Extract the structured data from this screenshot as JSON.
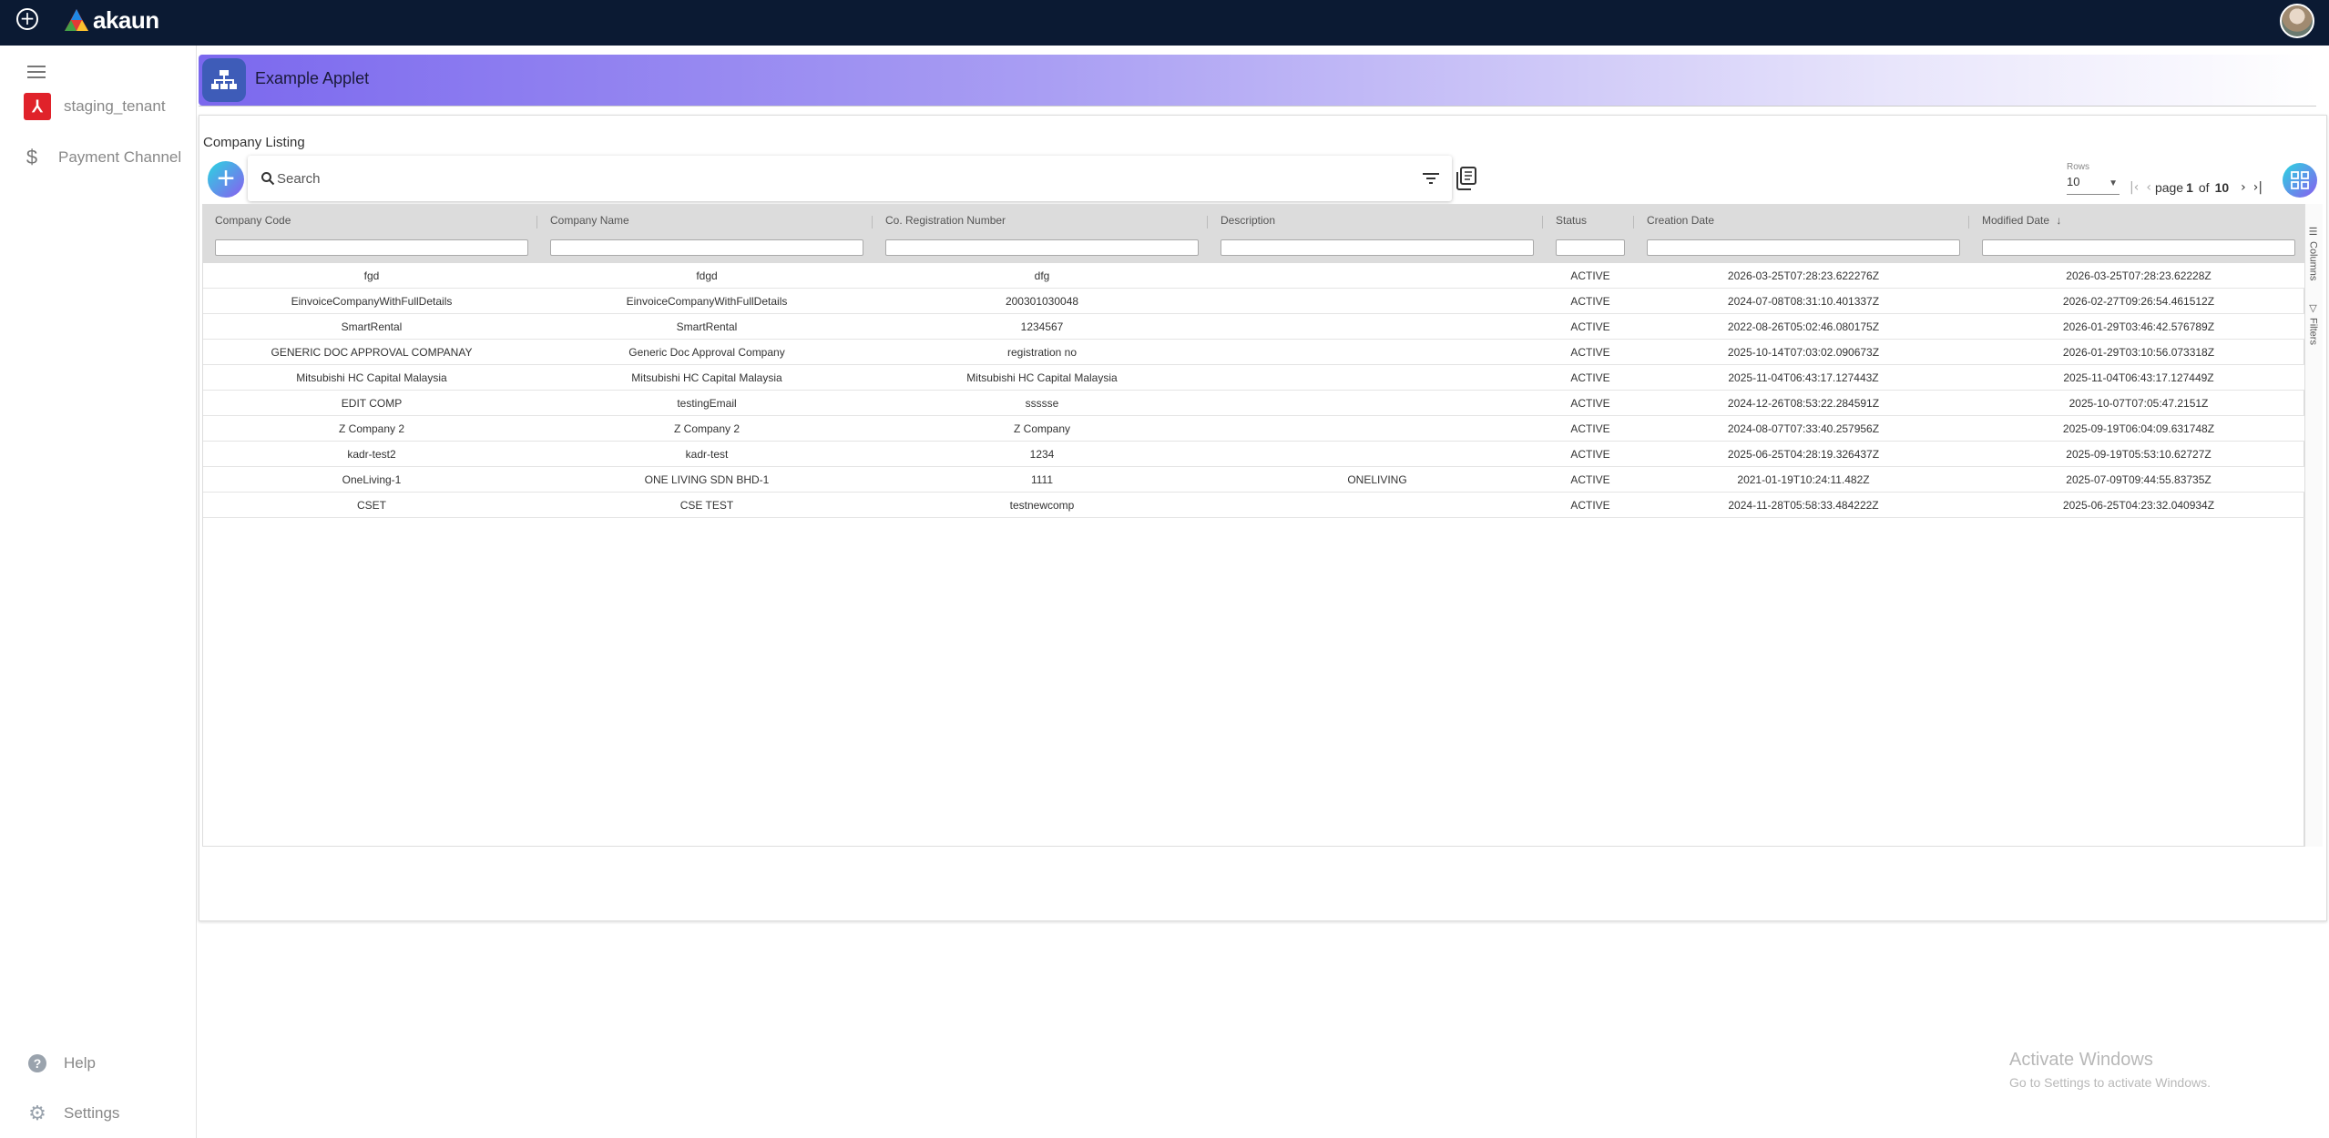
{
  "topbar": {
    "logo_text": "akaun",
    "add_icon": "plus-circle-icon",
    "avatar_icon": "user-avatar"
  },
  "sidebar": {
    "menu_icon": "hamburger-menu-icon",
    "tenant": {
      "label": "staging_tenant",
      "icon": "tenant-logo-icon"
    },
    "items": [
      {
        "label": "Payment Channel",
        "icon": "dollar-icon"
      }
    ],
    "help_label": "Help",
    "settings_label": "Settings"
  },
  "applet": {
    "title": "Example Applet",
    "icon": "sitemap-icon",
    "accent": "#7b68ee"
  },
  "listing": {
    "title": "Company Listing",
    "search_placeholder": "Search",
    "rows_label": "Rows",
    "rows_value": "10",
    "page_label": "page",
    "page_current": "1",
    "page_of": "of",
    "page_total": "10"
  },
  "table": {
    "columns": [
      "Company Code",
      "Company Name",
      "Co. Registration Number",
      "Description",
      "Status",
      "Creation Date",
      "Modified Date"
    ],
    "sort_indicator": "↓",
    "rows": [
      [
        "fgd",
        "fdgd",
        "dfg",
        "",
        "ACTIVE",
        "2026-03-25T07:28:23.622276Z",
        "2026-03-25T07:28:23.62228Z"
      ],
      [
        "EinvoiceCompanyWithFullDetails",
        "EinvoiceCompanyWithFullDetails",
        "200301030048",
        "",
        "ACTIVE",
        "2024-07-08T08:31:10.401337Z",
        "2026-02-27T09:26:54.461512Z"
      ],
      [
        "SmartRental",
        "SmartRental",
        "1234567",
        "",
        "ACTIVE",
        "2022-08-26T05:02:46.080175Z",
        "2026-01-29T03:46:42.576789Z"
      ],
      [
        "GENERIC DOC APPROVAL COMPANAY",
        "Generic Doc Approval Company",
        "registration no",
        "",
        "ACTIVE",
        "2025-10-14T07:03:02.090673Z",
        "2026-01-29T03:10:56.073318Z"
      ],
      [
        "Mitsubishi HC Capital Malaysia",
        "Mitsubishi HC Capital Malaysia",
        "Mitsubishi HC Capital Malaysia",
        "",
        "ACTIVE",
        "2025-11-04T06:43:17.127443Z",
        "2025-11-04T06:43:17.127449Z"
      ],
      [
        "EDIT COMP",
        "testingEmail",
        "ssssse",
        "",
        "ACTIVE",
        "2024-12-26T08:53:22.284591Z",
        "2025-10-07T07:05:47.2151Z"
      ],
      [
        "Z Company 2",
        "Z Company 2",
        "Z Company",
        "",
        "ACTIVE",
        "2024-08-07T07:33:40.257956Z",
        "2025-09-19T06:04:09.631748Z"
      ],
      [
        "kadr-test2",
        "kadr-test",
        "1234",
        "",
        "ACTIVE",
        "2025-06-25T04:28:19.326437Z",
        "2025-09-19T05:53:10.62727Z"
      ],
      [
        "OneLiving-1",
        "ONE LIVING SDN BHD-1",
        "1111",
        "ONELIVING",
        "ACTIVE",
        "2021-01-19T10:24:11.482Z",
        "2025-07-09T09:44:55.83735Z"
      ],
      [
        "CSET",
        "CSE TEST",
        "testnewcomp",
        "",
        "ACTIVE",
        "2024-11-28T05:58:33.484222Z",
        "2025-06-25T04:23:32.040934Z"
      ]
    ],
    "side_tabs": [
      "Columns",
      "Filters"
    ]
  },
  "watermark": {
    "title": "Activate Windows",
    "subtitle": "Go to Settings to activate Windows."
  }
}
